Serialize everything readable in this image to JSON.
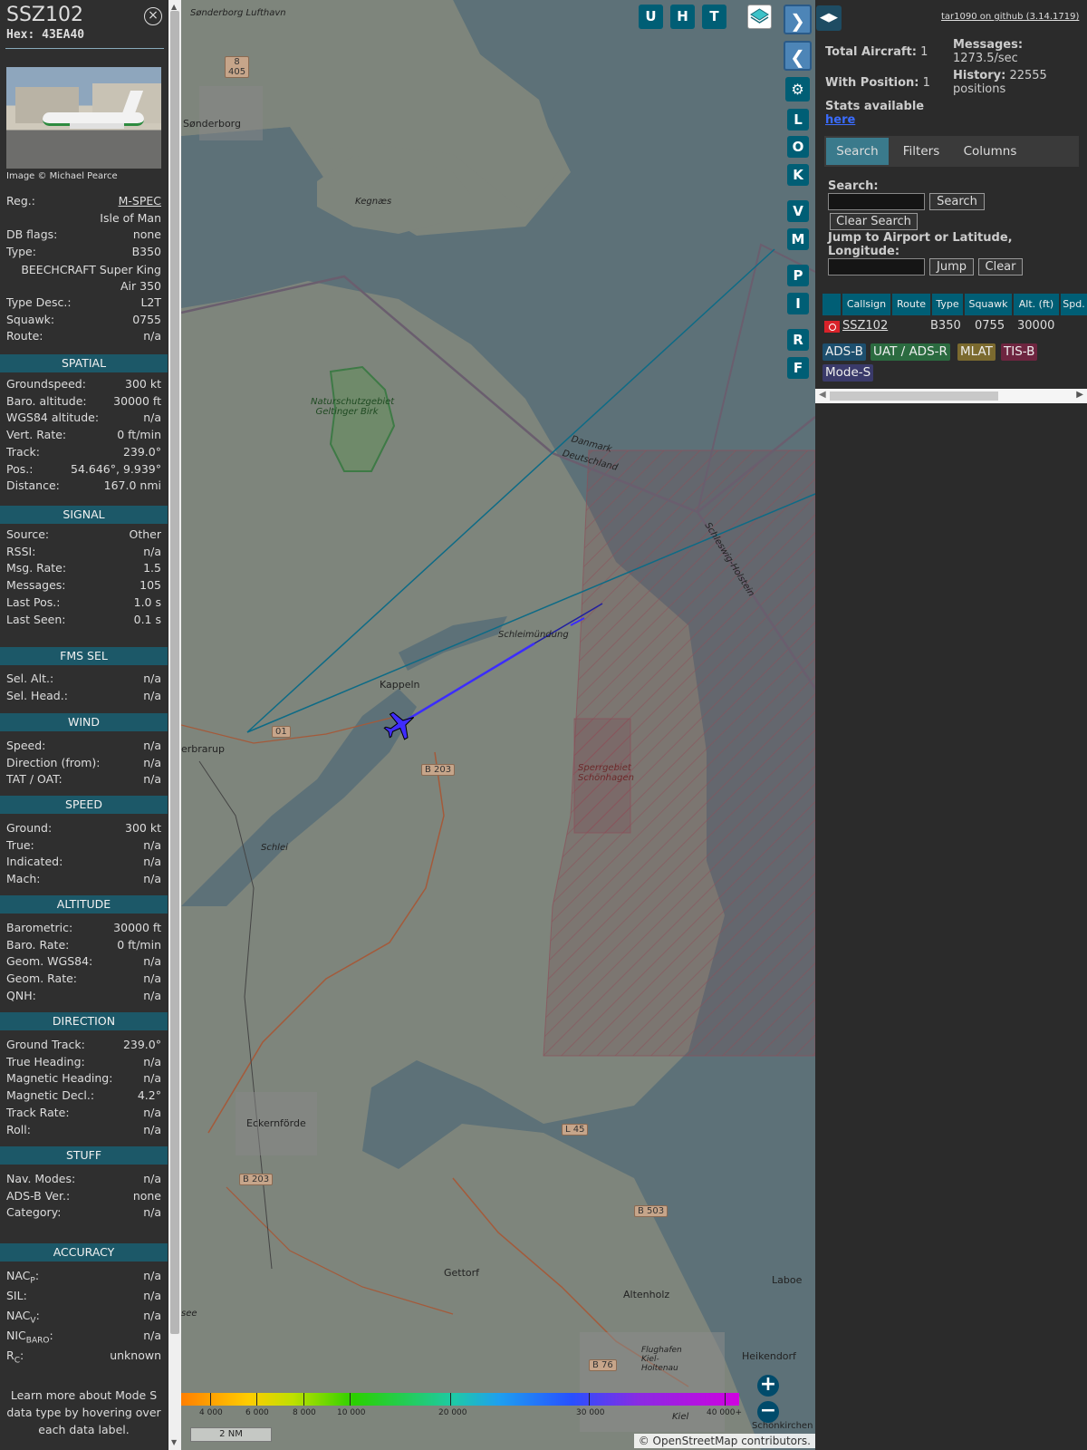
{
  "info": {
    "callsign": "SSZ102",
    "hex_label": "Hex:",
    "hex": "43EA40",
    "photo_credit": "Image © Michael Pearce",
    "registration": {
      "label": "Reg.:",
      "value": "M-SPEC"
    },
    "country": "Isle of Man",
    "db_flags": {
      "label": "DB flags:",
      "value": "none"
    },
    "type": {
      "label": "Type:",
      "value": "B350"
    },
    "type_name": "BEECHCRAFT Super King Air 350",
    "type_desc": {
      "label": "Type Desc.:",
      "value": "L2T"
    },
    "squawk": {
      "label": "Squawk:",
      "value": "0755"
    },
    "route": {
      "label": "Route:",
      "value": "n/a"
    },
    "sections": {
      "spatial": "SPATIAL",
      "signal": "SIGNAL",
      "fms_sel": "FMS SEL",
      "wind": "WIND",
      "speed": "SPEED",
      "altitude": "ALTITUDE",
      "direction": "DIRECTION",
      "stuff": "STUFF",
      "accuracy": "ACCURACY"
    },
    "spatial": [
      {
        "label": "Groundspeed:",
        "value": "300 kt"
      },
      {
        "label": "Baro. altitude:",
        "value": "30000 ft"
      },
      {
        "label": "WGS84 altitude:",
        "value": "n/a"
      },
      {
        "label": "Vert. Rate:",
        "value": "0 ft/min"
      },
      {
        "label": "Track:",
        "value": "239.0°"
      },
      {
        "label": "Pos.:",
        "value": "54.646°, 9.939°"
      },
      {
        "label": "Distance:",
        "value": "167.0 nmi"
      }
    ],
    "signal": [
      {
        "label": "Source:",
        "value": "Other"
      },
      {
        "label": "RSSI:",
        "value": "n/a"
      },
      {
        "label": "Msg. Rate:",
        "value": "1.5"
      },
      {
        "label": "Messages:",
        "value": "105"
      },
      {
        "label": "Last Pos.:",
        "value": "1.0 s"
      },
      {
        "label": "Last Seen:",
        "value": "0.1 s"
      }
    ],
    "fms_sel": [
      {
        "label": "Sel. Alt.:",
        "value": "n/a"
      },
      {
        "label": "Sel. Head.:",
        "value": "n/a"
      }
    ],
    "wind": [
      {
        "label": "Speed:",
        "value": "n/a"
      },
      {
        "label": "Direction (from):",
        "value": "n/a"
      },
      {
        "label": "TAT / OAT:",
        "value": "n/a"
      }
    ],
    "speed": [
      {
        "label": "Ground:",
        "value": "300 kt"
      },
      {
        "label": "True:",
        "value": "n/a"
      },
      {
        "label": "Indicated:",
        "value": "n/a"
      },
      {
        "label": "Mach:",
        "value": "n/a"
      }
    ],
    "altitude": [
      {
        "label": "Barometric:",
        "value": "30000 ft"
      },
      {
        "label": "Baro. Rate:",
        "value": "0 ft/min"
      },
      {
        "label": "Geom. WGS84:",
        "value": "n/a"
      },
      {
        "label": "Geom. Rate:",
        "value": "n/a"
      },
      {
        "label": "QNH:",
        "value": "n/a"
      }
    ],
    "direction": [
      {
        "label": "Ground Track:",
        "value": "239.0°"
      },
      {
        "label": "True Heading:",
        "value": "n/a"
      },
      {
        "label": "Magnetic Heading:",
        "value": "n/a"
      },
      {
        "label": "Magnetic Decl.:",
        "value": "4.2°"
      },
      {
        "label": "Track Rate:",
        "value": "n/a"
      },
      {
        "label": "Roll:",
        "value": "n/a"
      }
    ],
    "stuff": [
      {
        "label": "Nav. Modes:",
        "value": "n/a"
      },
      {
        "label": "ADS-B Ver.:",
        "value": "none"
      },
      {
        "label": "Category:",
        "value": "n/a"
      }
    ],
    "accuracy": [
      {
        "label": "NAC",
        "sub": "P",
        "value": "n/a"
      },
      {
        "label": "SIL:",
        "value": "n/a"
      },
      {
        "label": "NAC",
        "sub": "V",
        "value": "n/a"
      },
      {
        "label": "NIC",
        "sub": "BARO",
        "value": "n/a"
      },
      {
        "label": "R",
        "sub": "C",
        "value": "unknown"
      }
    ],
    "learn_more": "Learn more about Mode S data type by hovering over each data label."
  },
  "map": {
    "buttons_top": [
      "U",
      "H",
      "T"
    ],
    "buttons_side": [
      "L",
      "O",
      "K",
      "V",
      "M",
      "P",
      "I",
      "R",
      "F"
    ],
    "places": {
      "sonderborg_lufthavn": "Sønderborg Lufthavn",
      "sonderborg": "Sønderborg",
      "kegnaes": "Kegnæs",
      "naturschutz": "Naturschutzgebiet Geltinger Birk",
      "danmark": "Danmark",
      "deutschland": "Deutschland",
      "schleswig_holstein": "Schleswig-Holstein",
      "schleimuendung": "Schleimündung",
      "kappeln": "Kappeln",
      "erbrarup": "erbrarup",
      "sperrgebiet": "Sperrgebiet Schönhagen",
      "schlei": "Schlei",
      "eckernfoerde": "Eckernförde",
      "gettorf": "Gettorf",
      "altenholz": "Altenholz",
      "laboe": "Laboe",
      "heikendorf": "Heikendorf",
      "flughafen": "Flughafen Kiel-Holtenau",
      "kiel": "Kiel",
      "schoenkirchen": "Schönkirchen",
      "see": "see"
    },
    "roads": {
      "r8_405": "8\n405",
      "b203": "B 203",
      "b203b": "B 203",
      "l45": "L 45",
      "b503": "B 503",
      "b76": "B 76",
      "r01": "01"
    },
    "altitude_scale": [
      "4 000",
      "6 000",
      "8 000",
      "10 000",
      "20 000",
      "30 000",
      "40 000+"
    ],
    "scale_bar": "2 NM",
    "attribution": "© OpenStreetMap contributors."
  },
  "right": {
    "github_link": "tar1090 on github (3.14.1719)",
    "total_aircraft_label": "Total Aircraft:",
    "total_aircraft": "1",
    "with_position_label": "With Position:",
    "with_position": "1",
    "messages_label": "Messages:",
    "messages": "1273.5/sec",
    "history_label": "History:",
    "history": "22555",
    "history_unit": "positions",
    "stats_label": "Stats available",
    "stats_link": "here",
    "tabs": [
      "Search",
      "Filters",
      "Columns"
    ],
    "search_label": "Search:",
    "search_button": "Search",
    "clear_search_button": "Clear Search",
    "jump_label": "Jump to Airport or Latitude, Longitude:",
    "jump_button": "Jump",
    "clear_button": "Clear",
    "table": {
      "headers": [
        "",
        "Callsign",
        "Route",
        "Type",
        "Squawk",
        "Alt. (ft)",
        "Spd."
      ],
      "rows": [
        {
          "callsign": "SSZ102",
          "route": "",
          "type": "B350",
          "squawk": "0755",
          "alt": "30000",
          "spd": ""
        }
      ]
    },
    "sources": [
      "ADS-B",
      "UAT / ADS-R",
      "MLAT",
      "TIS-B",
      "Mode-S"
    ],
    "colors": {
      "adsb": "#1d4f6e",
      "uat": "#2b6b40",
      "mlat": "#7b6a2f",
      "tisb": "#6e2540",
      "modes": "#3a3a6a"
    }
  }
}
